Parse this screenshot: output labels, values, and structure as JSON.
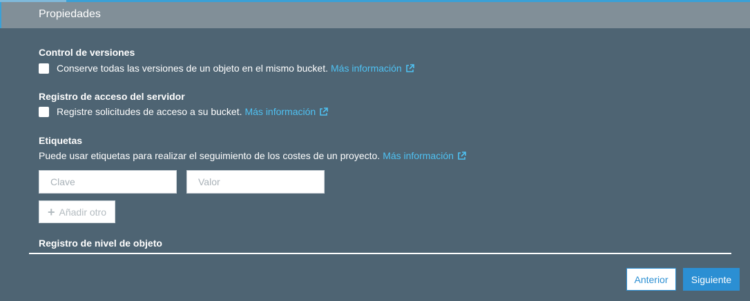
{
  "header": {
    "title": "Propiedades"
  },
  "versioning": {
    "title": "Control de versiones",
    "text": "Conserve todas las versiones de un objeto en el mismo bucket.",
    "link": "Más información"
  },
  "server_access_logging": {
    "title": "Registro de acceso del servidor",
    "text": "Registre solicitudes de acceso a su bucket.",
    "link": "Más información"
  },
  "tags": {
    "title": "Etiquetas",
    "text": "Puede usar etiquetas para realizar el seguimiento de los costes de un proyecto.",
    "link": "Más información",
    "key_placeholder": "Clave",
    "value_placeholder": "Valor",
    "add_label": "Añadir otro"
  },
  "object_logging": {
    "title": "Registro de nivel de objeto"
  },
  "footer": {
    "prev_label": "Anterior",
    "next_label": "Siguiente"
  },
  "colors": {
    "background": "#4e6473",
    "header": "#818f98",
    "link": "#4fc1f2",
    "primary": "#2b8fd3"
  },
  "icons": {
    "external": "external-link-icon",
    "plus": "plus-icon"
  }
}
